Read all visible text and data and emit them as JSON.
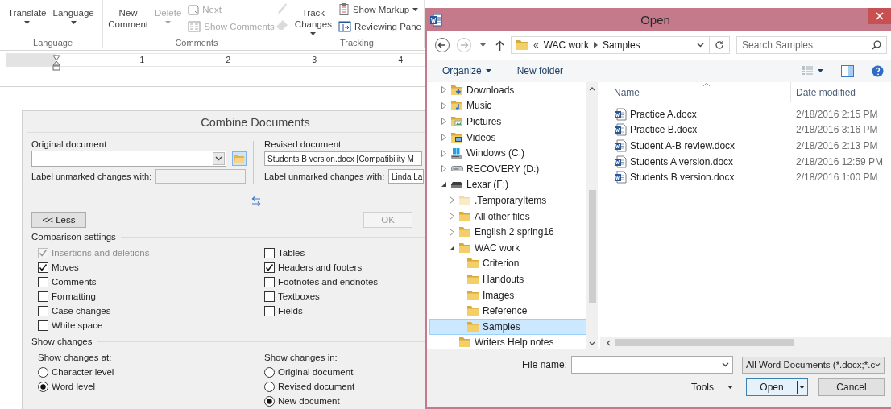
{
  "word": {
    "ribbon_groups": [
      {
        "label": "Language",
        "items": [
          {
            "kind": "large",
            "label": "Translate",
            "dropdown": true,
            "disabled": false
          },
          {
            "kind": "large",
            "label": "Language",
            "dropdown": true,
            "disabled": false
          }
        ]
      },
      {
        "label": "Comments",
        "items": [
          {
            "kind": "large",
            "label": "New Comment",
            "dropdown": false,
            "disabled": false
          },
          {
            "kind": "large",
            "label": "Delete",
            "dropdown": true,
            "disabled": true
          },
          {
            "kind": "small",
            "label": "Next",
            "dropdown": false,
            "disabled": true
          },
          {
            "kind": "small",
            "label": "Show Comments",
            "dropdown": false,
            "disabled": true
          },
          {
            "kind": "icon",
            "disabled": true
          },
          {
            "kind": "icon",
            "disabled": true
          }
        ]
      },
      {
        "label": "Tracking",
        "items": [
          {
            "kind": "large",
            "label": "Track Changes",
            "dropdown": true,
            "disabled": false
          },
          {
            "kind": "small",
            "label": "Show Markup",
            "dropdown": true,
            "disabled": false
          },
          {
            "kind": "small",
            "label": "Reviewing Pane",
            "dropdown": false,
            "disabled": false
          }
        ]
      }
    ],
    "ruler_marks": [
      "1",
      "2",
      "3",
      "4"
    ]
  },
  "combine_dialog": {
    "title": "Combine Documents",
    "original": {
      "label": "Original document",
      "unmarked_label": "Label unmarked changes with:"
    },
    "revised": {
      "label": "Revised document",
      "value": "Students B version.docx [Compatibility M",
      "unmarked_label": "Label unmarked changes with:",
      "unmarked_value": "Linda La"
    },
    "less_button": "<< Less",
    "ok_button": {
      "label": "OK",
      "disabled": true
    },
    "comparison_settings": {
      "title": "Comparison settings",
      "columns": [
        [
          {
            "label": "Insertions and deletions",
            "checked": true,
            "disabled": true
          },
          {
            "label": "Moves",
            "checked": true,
            "disabled": false
          },
          {
            "label": "Comments",
            "checked": false,
            "disabled": false
          },
          {
            "label": "Formatting",
            "checked": false,
            "disabled": false
          },
          {
            "label": "Case changes",
            "checked": false,
            "disabled": false
          },
          {
            "label": "White space",
            "checked": false,
            "disabled": false
          }
        ],
        [
          {
            "label": "Tables",
            "checked": false,
            "disabled": false
          },
          {
            "label": "Headers and footers",
            "checked": true,
            "disabled": false
          },
          {
            "label": "Footnotes and endnotes",
            "checked": false,
            "disabled": false
          },
          {
            "label": "Textboxes",
            "checked": false,
            "disabled": false
          },
          {
            "label": "Fields",
            "checked": false,
            "disabled": false
          }
        ]
      ]
    },
    "show_changes": {
      "title": "Show changes",
      "groups": [
        {
          "label": "Show changes at:",
          "options": [
            {
              "label": "Character level",
              "selected": false
            },
            {
              "label": "Word level",
              "selected": true
            }
          ]
        },
        {
          "label": "Show changes in:",
          "options": [
            {
              "label": "Original document",
              "selected": false
            },
            {
              "label": "Revised document",
              "selected": false
            },
            {
              "label": "New document",
              "selected": true
            }
          ]
        }
      ]
    }
  },
  "open_dialog": {
    "title": "Open",
    "address": {
      "overflow": "«",
      "path": [
        "WAC work",
        "Samples"
      ]
    },
    "search": {
      "placeholder": "Search Samples"
    },
    "toolbar": [
      {
        "label": "Organize",
        "dropdown": true
      },
      {
        "label": "New folder",
        "dropdown": false
      }
    ],
    "navigation_tree": [
      {
        "label": "Downloads",
        "kind": "downloads",
        "expandable": true,
        "expanded": false,
        "selected": false
      },
      {
        "label": "Music",
        "kind": "music",
        "expandable": true,
        "expanded": false,
        "selected": false
      },
      {
        "label": "Pictures",
        "kind": "pictures",
        "expandable": true,
        "expanded": false,
        "selected": false
      },
      {
        "label": "Videos",
        "kind": "videos",
        "expandable": true,
        "expanded": false,
        "selected": false
      },
      {
        "label": "Windows (C:)",
        "kind": "systemdrive",
        "expandable": true,
        "expanded": false,
        "selected": false
      },
      {
        "label": "RECOVERY (D:)",
        "kind": "drive",
        "expandable": true,
        "expanded": false,
        "selected": false
      },
      {
        "label": "Lexar (F:)",
        "kind": "usbdrive",
        "expandable": true,
        "expanded": true,
        "selected": false,
        "children": [
          {
            "label": ".TemporaryItems",
            "kind": "hiddenfolder",
            "expandable": true,
            "expanded": false,
            "selected": false
          },
          {
            "label": "All other files",
            "kind": "folder",
            "expandable": true,
            "expanded": false,
            "selected": false
          },
          {
            "label": "English 2 spring16",
            "kind": "folder",
            "expandable": true,
            "expanded": false,
            "selected": false
          },
          {
            "label": "WAC work",
            "kind": "folder",
            "expandable": true,
            "expanded": true,
            "selected": false,
            "children": [
              {
                "label": "Criterion",
                "kind": "folder",
                "expandable": false,
                "selected": false
              },
              {
                "label": "Handouts",
                "kind": "folder",
                "expandable": false,
                "selected": false
              },
              {
                "label": "Images",
                "kind": "folder",
                "expandable": false,
                "selected": false
              },
              {
                "label": "Reference",
                "kind": "folder",
                "expandable": false,
                "selected": false
              },
              {
                "label": "Samples",
                "kind": "folder",
                "expandable": false,
                "selected": true
              }
            ]
          },
          {
            "label": "Writers Help notes",
            "kind": "folder",
            "expandable": false,
            "selected": false
          }
        ]
      }
    ],
    "columns": [
      {
        "label": "Name",
        "sorted": true
      },
      {
        "label": "Date modified",
        "sorted": false
      }
    ],
    "files": [
      {
        "name": "Practice A.docx",
        "date_modified": "2/18/2016 2:15 PM"
      },
      {
        "name": "Practice B.docx",
        "date_modified": "2/18/2016 3:16 PM"
      },
      {
        "name": "Student A-B review.docx",
        "date_modified": "2/18/2016 2:13 PM"
      },
      {
        "name": "Students A version.docx",
        "date_modified": "2/18/2016 12:59 PM"
      },
      {
        "name": "Students B version.docx",
        "date_modified": "2/18/2016 1:00 PM"
      }
    ],
    "file_name_label": "File name:",
    "file_type": "All Word Documents (*.docx;*.c",
    "tools_button": "Tools",
    "open_button": "Open",
    "cancel_button": "Cancel"
  }
}
